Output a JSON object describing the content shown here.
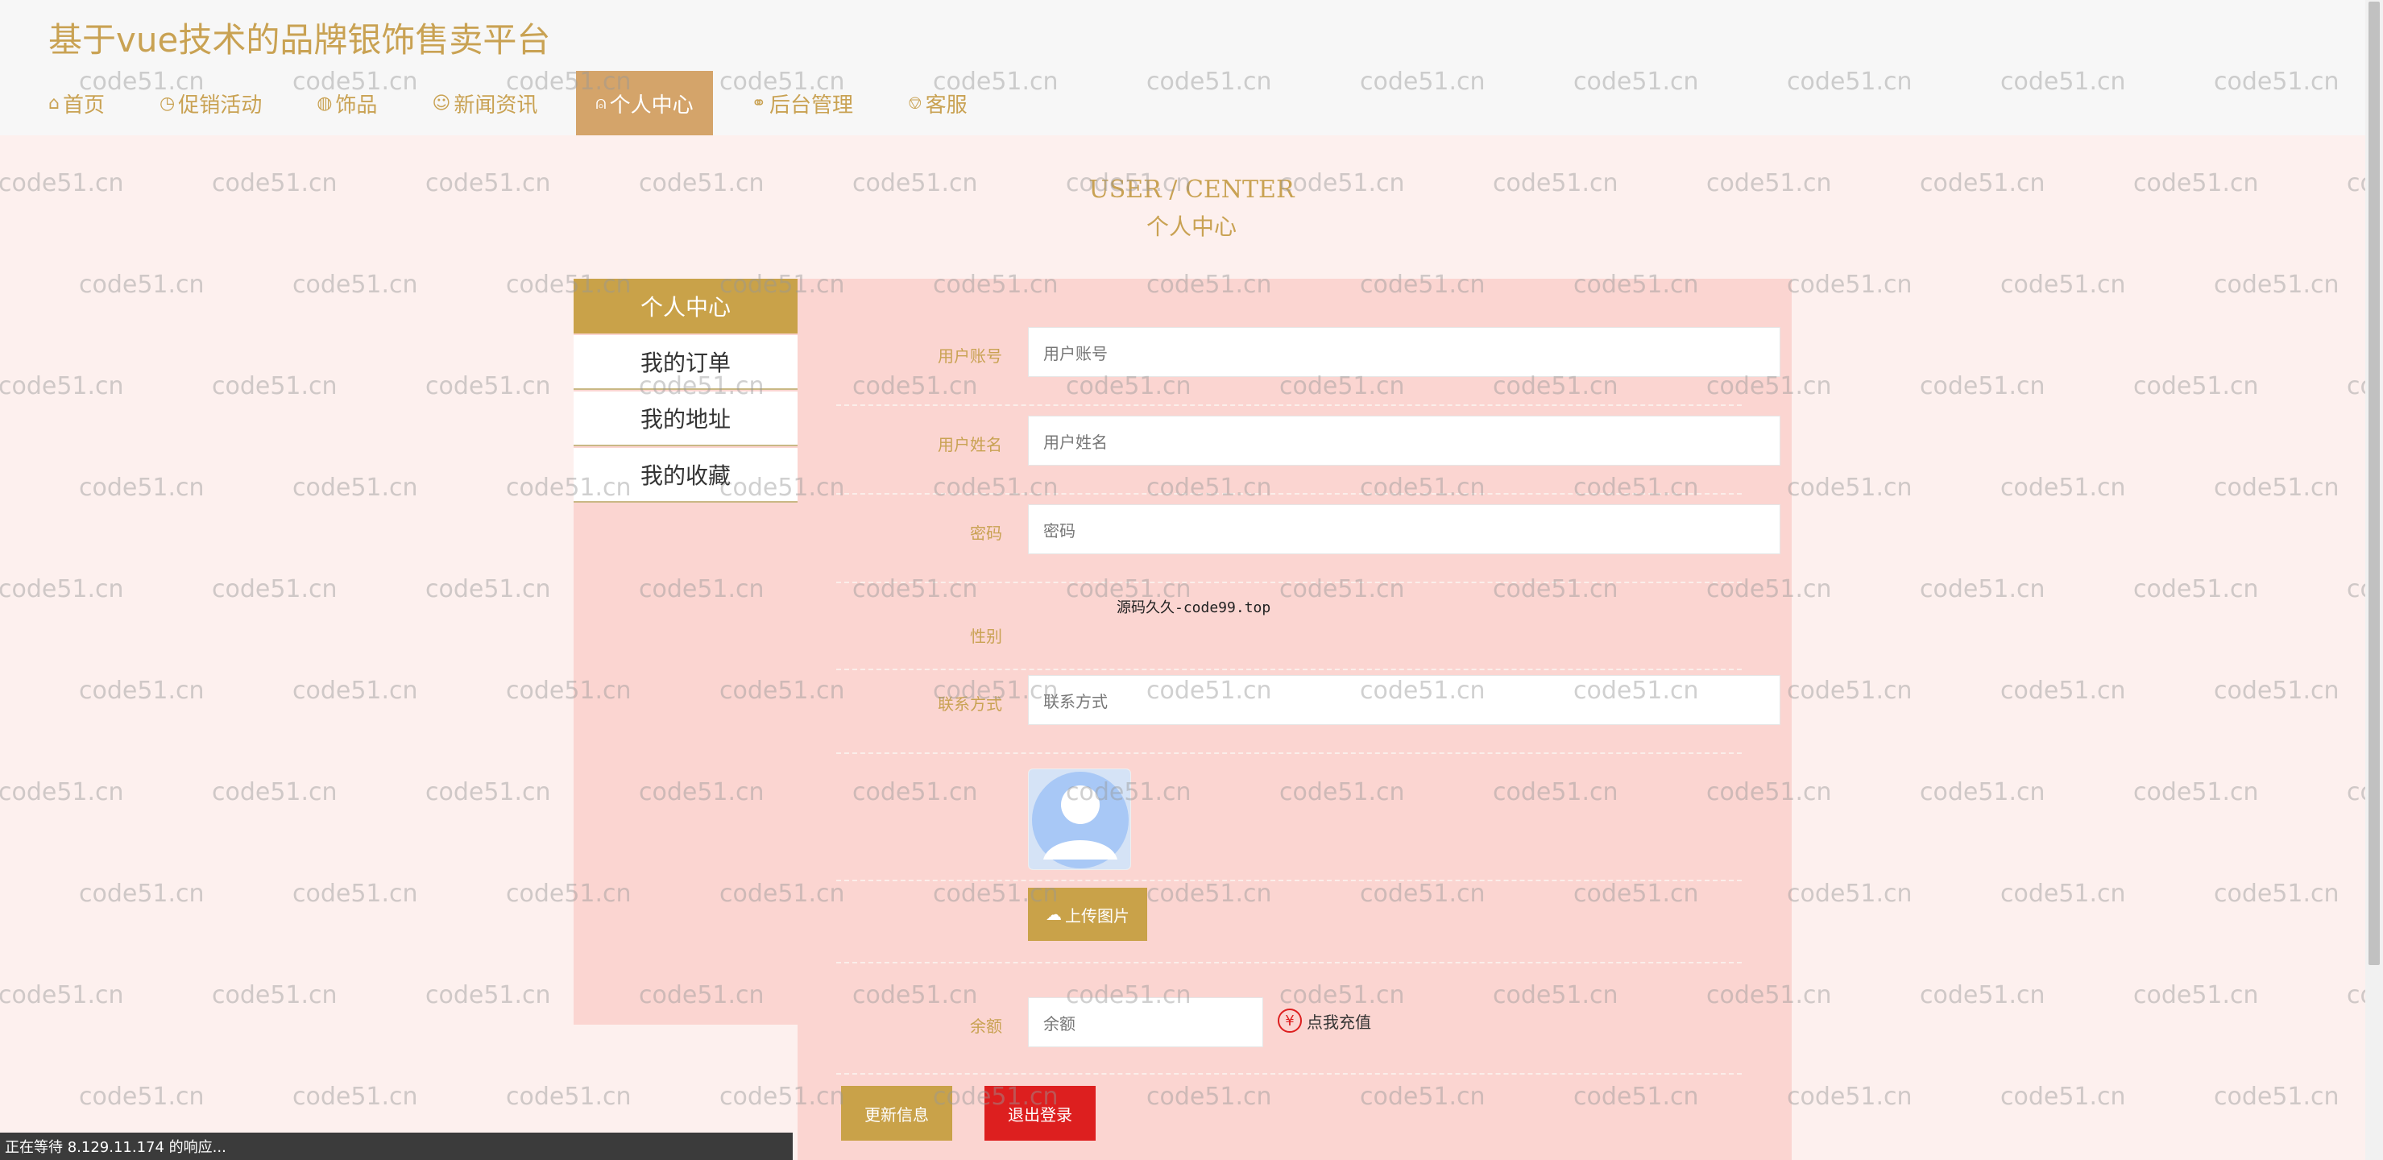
{
  "header": {
    "site_title": "基于vue技术的品牌银饰售卖平台",
    "nav": [
      {
        "label": "首页",
        "icon": "home-icon",
        "glyph": "⌂"
      },
      {
        "label": "促销活动",
        "icon": "clock-icon",
        "glyph": "◷"
      },
      {
        "label": "饰品",
        "icon": "globe-icon",
        "glyph": "◍"
      },
      {
        "label": "新闻资讯",
        "icon": "smile-icon",
        "glyph": "☺"
      },
      {
        "label": "个人中心",
        "icon": "user-icon",
        "glyph": "⍝"
      },
      {
        "label": "后台管理",
        "icon": "link-icon",
        "glyph": "⚭"
      },
      {
        "label": "客服",
        "icon": "chat-icon",
        "glyph": "⎊"
      }
    ],
    "active_nav": "个人中心"
  },
  "heading": {
    "en": "USER / CENTER",
    "cn": "个人中心"
  },
  "sidebar": {
    "title": "个人中心",
    "items": [
      "我的订单",
      "我的地址",
      "我的收藏"
    ]
  },
  "form": {
    "account": {
      "label": "用户账号",
      "placeholder": "用户账号"
    },
    "name": {
      "label": "用户姓名",
      "placeholder": "用户姓名"
    },
    "password": {
      "label": "密码",
      "placeholder": "密码"
    },
    "gender": {
      "label": "性别",
      "note": "源码久久-code99.top"
    },
    "contact": {
      "label": "联系方式",
      "placeholder": "联系方式"
    },
    "upload_label": "上传图片",
    "balance": {
      "label": "余额",
      "placeholder": "余额"
    },
    "recharge_label": "点我充值",
    "recharge_glyph": "¥",
    "update_label": "更新信息",
    "logout_label": "退出登录"
  },
  "status_bar": "正在等待 8.129.11.174 的响应...",
  "watermark": "code51.cn",
  "colors": {
    "gold": "#c9a253",
    "active_nav": "#d4a46a",
    "panel": "#fbd5d1",
    "logout_red": "#dd1f1f"
  }
}
